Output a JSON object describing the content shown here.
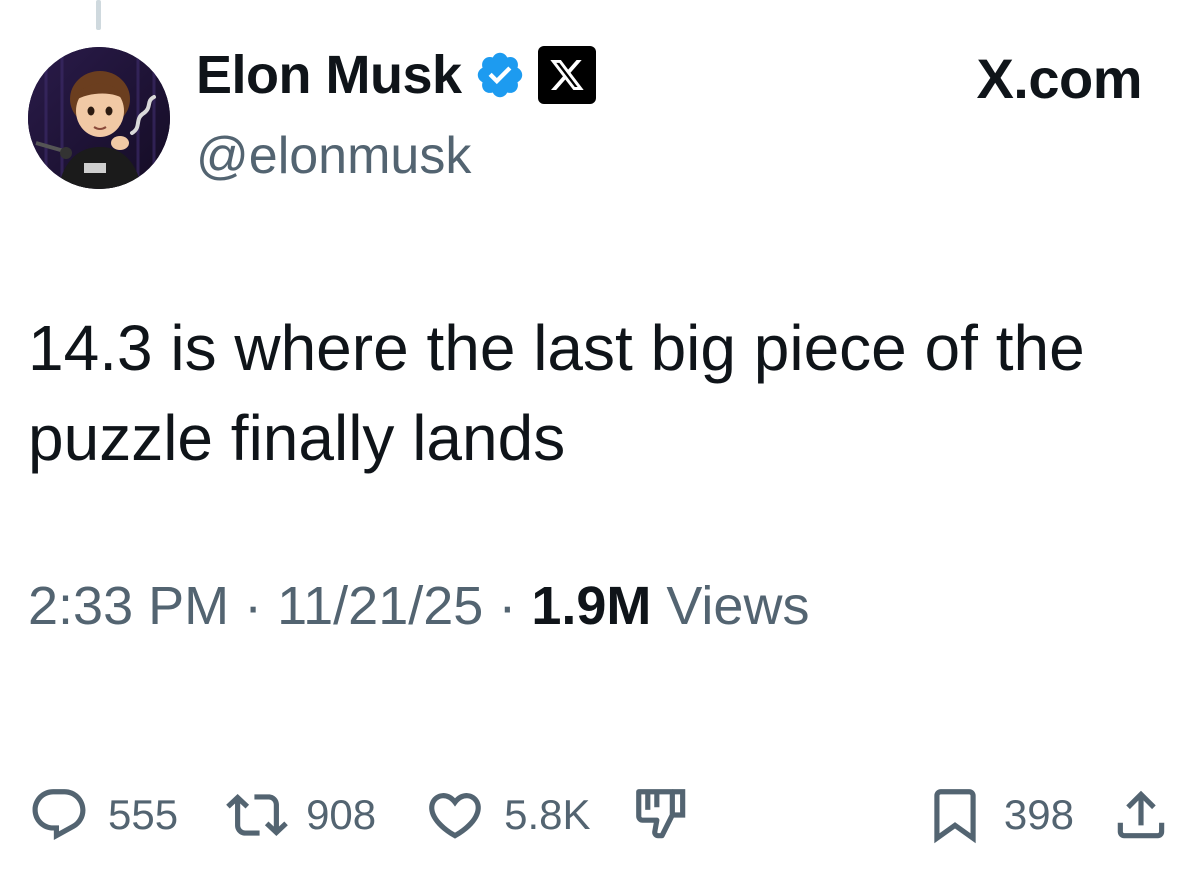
{
  "tweet": {
    "author": {
      "display_name": "Elon Musk",
      "handle": "@elonmusk",
      "avatar_icon": "avatar-image",
      "verified_icon": "verified-badge-icon",
      "affiliate_icon": "x-logo-icon"
    },
    "source_label": "X.com",
    "text": "14.3 is where the last big piece of the puzzle finally lands",
    "time": "2:33 PM",
    "separator": " · ",
    "date": "11/21/25",
    "views_count": "1.9M",
    "views_label": "Views",
    "actions": {
      "replies": "555",
      "reposts": "908",
      "likes": "5.8K",
      "bookmarks": "398"
    }
  },
  "colors": {
    "text": "#0f1419",
    "secondary": "#536471",
    "verified_blue": "#1d9bf0",
    "background": "#ffffff"
  }
}
